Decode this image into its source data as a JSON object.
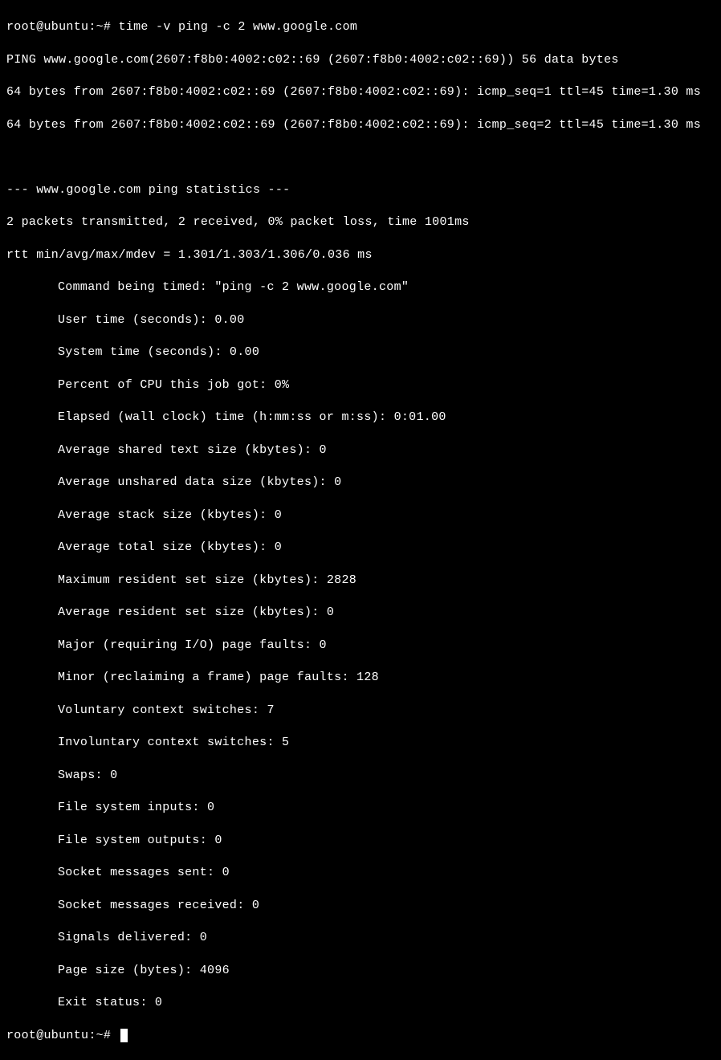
{
  "prompt1": "root@ubuntu:~# ",
  "command": "time -v ping -c 2 www.google.com",
  "ping_header": "PING www.google.com(2607:f8b0:4002:c02::69 (2607:f8b0:4002:c02::69)) 56 data bytes",
  "ping_reply1": "64 bytes from 2607:f8b0:4002:c02::69 (2607:f8b0:4002:c02::69): icmp_seq=1 ttl=45 time=1.30 ms",
  "ping_reply2": "64 bytes from 2607:f8b0:4002:c02::69 (2607:f8b0:4002:c02::69): icmp_seq=2 ttl=45 time=1.30 ms",
  "stats_header": "--- www.google.com ping statistics ---",
  "stats_summary": "2 packets transmitted, 2 received, 0% packet loss, time 1001ms",
  "rtt": "rtt min/avg/max/mdev = 1.301/1.303/1.306/0.036 ms",
  "timed": {
    "command_being_timed": "Command being timed: \"ping -c 2 www.google.com\"",
    "user_time": "User time (seconds): 0.00",
    "system_time": "System time (seconds): 0.00",
    "percent_cpu": "Percent of CPU this job got: 0%",
    "elapsed": "Elapsed (wall clock) time (h:mm:ss or m:ss): 0:01.00",
    "avg_shared_text": "Average shared text size (kbytes): 0",
    "avg_unshared_data": "Average unshared data size (kbytes): 0",
    "avg_stack": "Average stack size (kbytes): 0",
    "avg_total": "Average total size (kbytes): 0",
    "max_rss": "Maximum resident set size (kbytes): 2828",
    "avg_rss": "Average resident set size (kbytes): 0",
    "major_faults": "Major (requiring I/O) page faults: 0",
    "minor_faults": "Minor (reclaiming a frame) page faults: 128",
    "voluntary_ctx": "Voluntary context switches: 7",
    "involuntary_ctx": "Involuntary context switches: 5",
    "swaps": "Swaps: 0",
    "fs_inputs": "File system inputs: 0",
    "fs_outputs": "File system outputs: 0",
    "sock_sent": "Socket messages sent: 0",
    "sock_recv": "Socket messages received: 0",
    "signals": "Signals delivered: 0",
    "page_size": "Page size (bytes): 4096",
    "exit_status": "Exit status: 0"
  },
  "prompt2": "root@ubuntu:~# "
}
